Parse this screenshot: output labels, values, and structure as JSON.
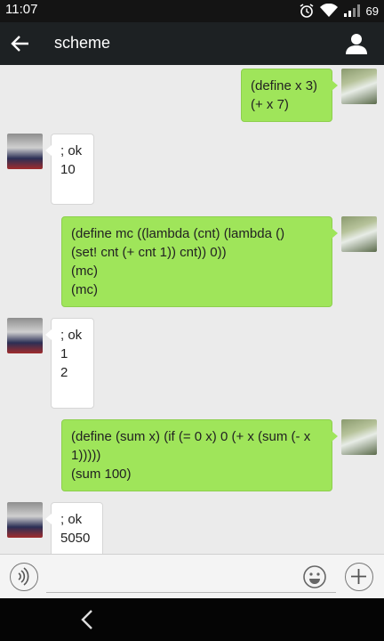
{
  "status_bar": {
    "time": "11:07",
    "battery": "69"
  },
  "app_bar": {
    "title": "scheme"
  },
  "messages": [
    {
      "sender": "me",
      "text": "(define x 3)\n(+ x 7)"
    },
    {
      "sender": "bot",
      "text": "; ok\n10"
    },
    {
      "sender": "me",
      "text": "(define mc ((lambda (cnt) (lambda ()\n(set! cnt (+ cnt 1)) cnt)) 0))\n(mc)\n(mc)"
    },
    {
      "sender": "bot",
      "text": "; ok\n1\n2"
    },
    {
      "sender": "me",
      "text": "(define (sum x) (if (= 0 x) 0 (+ x (sum (- x\n1)))))\n(sum 100)"
    },
    {
      "sender": "bot",
      "text": "; ok\n5050"
    }
  ],
  "input": {
    "value": "",
    "placeholder": ""
  },
  "icons": [
    "alarm-icon",
    "wifi-icon",
    "signal-icon",
    "back-arrow-icon",
    "profile-icon",
    "voice-icon",
    "emoji-icon",
    "plus-icon",
    "nav-back-icon"
  ],
  "colors": {
    "my_bubble": "#9fe55a",
    "bot_bubble": "#ffffff",
    "app_bar": "#1d2123",
    "chat_bg": "#ebebeb"
  }
}
